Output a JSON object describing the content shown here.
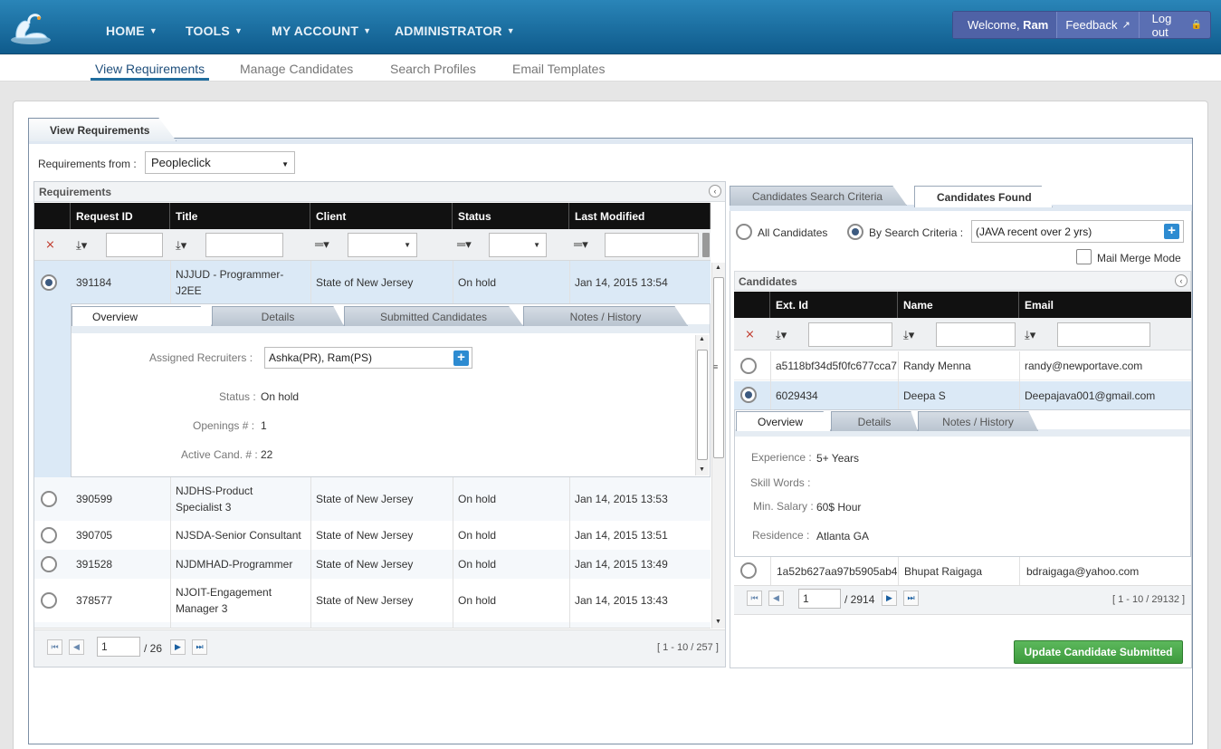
{
  "nav": {
    "items": [
      {
        "label": "HOME"
      },
      {
        "label": "TOOLS"
      },
      {
        "label": "MY ACCOUNT"
      },
      {
        "label": "ADMINISTRATOR"
      }
    ],
    "welcome_prefix": "Welcome, ",
    "welcome_user": "Ram",
    "feedback_label": "Feedback",
    "logout_label": "Log out"
  },
  "subnav": {
    "items": [
      "View Requirements",
      "Manage Candidates",
      "Search Profiles",
      "Email Templates"
    ],
    "active": "View Requirements"
  },
  "main_tab": "View Requirements",
  "requirements_from": {
    "label": "Requirements from :",
    "value": "Peopleclick"
  },
  "requirements": {
    "title": "Requirements",
    "columns": [
      "Request ID",
      "Title",
      "Client",
      "Status",
      "Last Modified"
    ],
    "rows": [
      {
        "id": "391184",
        "title1": "NJJUD - Programmer-",
        "title2": "J2EE",
        "client": "State of New Jersey",
        "status": "On hold",
        "modified": "Jan 14, 2015 13:54",
        "selected": true
      },
      {
        "id": "390599",
        "title1": "NJDHS-Product",
        "title2": "Specialist 3",
        "client": "State of New Jersey",
        "status": "On hold",
        "modified": "Jan 14, 2015 13:53"
      },
      {
        "id": "390705",
        "title1": "NJSDA-Senior Consultant",
        "title2": "",
        "client": "State of New Jersey",
        "status": "On hold",
        "modified": "Jan 14, 2015 13:51"
      },
      {
        "id": "391528",
        "title1": "NJDMHAD-Programmer",
        "title2": "",
        "client": "State of New Jersey",
        "status": "On hold",
        "modified": "Jan 14, 2015 13:49"
      },
      {
        "id": "378577",
        "title1": "NJOIT-Engagement",
        "title2": "Manager 3",
        "client": "State of New Jersey",
        "status": "On hold",
        "modified": "Jan 14, 2015 13:43"
      }
    ],
    "detail_tabs": [
      "Overview",
      "Details",
      "Submitted Candidates",
      "Notes / History"
    ],
    "detail": {
      "assigned_label": "Assigned Recruiters :",
      "assigned_value": "Ashka(PR), Ram(PS)",
      "status_label": "Status :",
      "status_value": "On hold",
      "openings_label": "Openings # :",
      "openings_value": "1",
      "active_label": "Active Cand. # :",
      "active_value": "22"
    },
    "pager": {
      "page": "1",
      "total": "/ 26",
      "range": "[ 1 - 10 / 257 ]"
    }
  },
  "candidates_panel": {
    "tabs": [
      "Candidates Search Criteria",
      "Candidates Found"
    ],
    "active_tab": "Candidates Found",
    "radio_all": "All Candidates",
    "radio_criteria": "By Search Criteria :",
    "criteria_value": "(JAVA recent over 2 yrs)",
    "mail_merge": "Mail Merge Mode",
    "title": "Candidates",
    "columns": [
      "Ext. Id",
      "Name",
      "Email"
    ],
    "rows": [
      {
        "ext": "a5118bf34d5f0fc677cca7",
        "name": "Randy Menna",
        "email": "randy@newportave.com"
      },
      {
        "ext": "6029434",
        "name": "Deepa S",
        "email": "Deepajava001@gmail.com",
        "selected": true
      },
      {
        "ext": "1a52b627aa97b5905ab4",
        "name": "Bhupat Raigaga",
        "email": "bdraigaga@yahoo.com"
      }
    ],
    "detail_tabs": [
      "Overview",
      "Details",
      "Notes / History"
    ],
    "detail": {
      "experience_label": "Experience :",
      "experience_value": "5+ Years",
      "skill_label": "Skill Words :",
      "salary_label": "Min. Salary :",
      "salary_value": "60$ Hour",
      "residence_label": "Residence :",
      "residence_value": "Atlanta GA"
    },
    "pager": {
      "page": "1",
      "total": "/ 2914",
      "range": "[ 1 - 10 / 29132 ]"
    },
    "update_button": "Update Candidate Submitted"
  },
  "colors": {
    "topbar": "#1a6fa3",
    "accent": "#2d8bd1",
    "green": "#4cae4c"
  }
}
